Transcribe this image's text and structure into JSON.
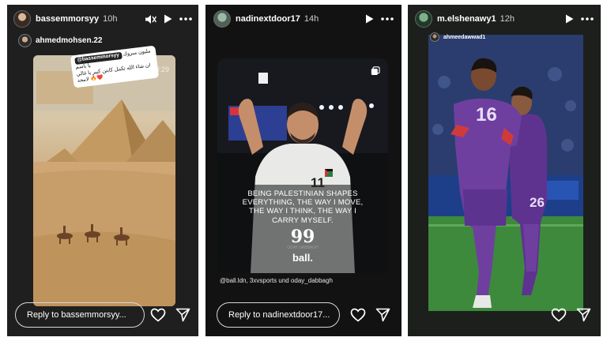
{
  "stories": [
    {
      "username": "bassemmorsyy",
      "time": "10h",
      "reshared_from": "ahmedmohsen.22",
      "sticker_tag": "@bassemmorsyy",
      "sticker_text_1": "مليون مبروك يا باسم",
      "sticker_text_2": "ان شاء الله تكمل كابتن كبير يا غالي",
      "sticker_text_3": "لامجد 🔥❤️",
      "video_time": "0:29",
      "reply_placeholder": "Reply to bassemmorsyy..."
    },
    {
      "username": "nadinextdoor17",
      "time": "14h",
      "jersey_number": "11",
      "quote": [
        "BEING PALESTINIAN SHAPES",
        "EVERYTHING, THE WAY I MOVE,",
        "THE WAY I THINK, THE WAY I",
        "CARRY MYSELF."
      ],
      "quote_mark": "99",
      "quote_author": "ODAY DABBAGH",
      "brand": "ball.",
      "credits": "@ball.ldn, 3xvsports und oday_dabbagh",
      "reply_placeholder": "Reply to nadinextdoor17..."
    },
    {
      "username": "m.elshenawy1",
      "time": "12h",
      "reshared_from": "ahmeedawwad1",
      "jersey_number_left": "16",
      "jersey_number_right": "26",
      "reply_placeholder": null
    }
  ],
  "icons": {
    "mute": "mute-icon",
    "play": "play-icon",
    "more": "more-icon",
    "heart": "heart-icon",
    "send": "send-icon",
    "multi": "multiple-images-icon"
  },
  "colors": {
    "story_bg": "#1f1f1f",
    "kit_purple": "#6f3fa0",
    "pitch_green": "#3d8a3c"
  }
}
